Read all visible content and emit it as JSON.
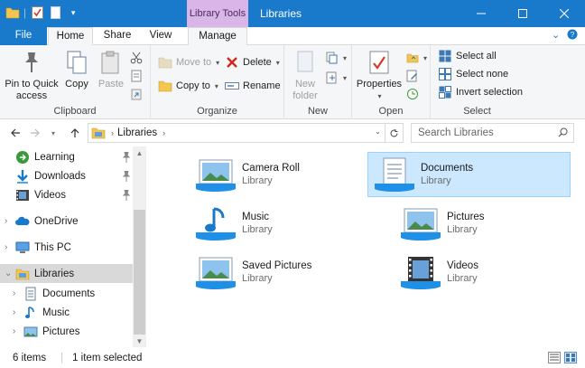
{
  "titlebar": {
    "context_tab": "Library Tools",
    "title": "Libraries",
    "controls": [
      "minimize",
      "maximize",
      "close"
    ]
  },
  "ribbon_tabs": {
    "file": "File",
    "home": "Home",
    "share": "Share",
    "view": "View",
    "manage": "Manage"
  },
  "ribbon": {
    "clipboard": {
      "label": "Clipboard",
      "pin": "Pin to Quick access",
      "copy": "Copy",
      "paste": "Paste"
    },
    "organize": {
      "label": "Organize",
      "move_to": "Move to",
      "copy_to": "Copy to",
      "delete": "Delete",
      "rename": "Rename"
    },
    "new": {
      "label": "New",
      "new_folder": "New folder"
    },
    "open": {
      "label": "Open",
      "properties": "Properties"
    },
    "select": {
      "label": "Select",
      "select_all": "Select all",
      "select_none": "Select none",
      "invert": "Invert selection"
    }
  },
  "address": {
    "breadcrumb": "Libraries",
    "search_placeholder": "Search Libraries"
  },
  "nav": {
    "items": [
      {
        "label": "Learning",
        "icon": "learning-icon",
        "pinned": true
      },
      {
        "label": "Downloads",
        "icon": "downloads-icon",
        "pinned": true
      },
      {
        "label": "Videos",
        "icon": "videos-icon",
        "pinned": true
      },
      {
        "label": "OneDrive",
        "icon": "onedrive-icon"
      },
      {
        "label": "This PC",
        "icon": "this-pc-icon"
      },
      {
        "label": "Libraries",
        "icon": "libraries-icon",
        "selected": true
      },
      {
        "label": "Documents",
        "icon": "documents-icon"
      },
      {
        "label": "Music",
        "icon": "music-icon"
      },
      {
        "label": "Pictures",
        "icon": "pictures-icon"
      }
    ]
  },
  "libraries": [
    {
      "name": "Camera Roll",
      "type": "Library",
      "icon": "camera-roll-icon"
    },
    {
      "name": "Documents",
      "type": "Library",
      "icon": "documents-library-icon",
      "selected": true
    },
    {
      "name": "Music",
      "type": "Library",
      "icon": "music-library-icon"
    },
    {
      "name": "Pictures",
      "type": "Library",
      "icon": "pictures-library-icon"
    },
    {
      "name": "Saved Pictures",
      "type": "Library",
      "icon": "saved-pictures-icon"
    },
    {
      "name": "Videos",
      "type": "Library",
      "icon": "videos-library-icon"
    }
  ],
  "status": {
    "items_count": "6 items",
    "selected": "1 item selected"
  },
  "colors": {
    "accent": "#1979ca",
    "context_tab": "#d9b6e7",
    "selection": "#cce8ff"
  }
}
